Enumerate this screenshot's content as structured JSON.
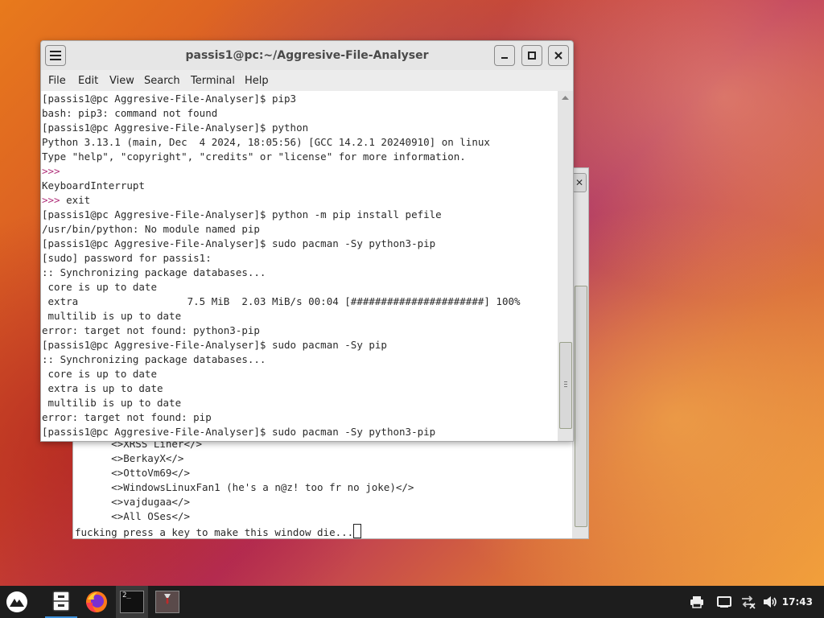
{
  "back_terminal": {
    "close_glyph": "✕",
    "lines": [
      "      <>XRSS Liner</>",
      "      <>BerkayX</>",
      "      <>OttoVm69</>",
      "      <>WindowsLinuxFan1 (he's a n@z! too fr no joke)</>",
      "      <>vajdugaa</>",
      "      <>All OSes</>"
    ],
    "last_line": "fucking press a key to make this window die..."
  },
  "front_terminal": {
    "title": "passis1@pc:~/Aggresive-File-Analyser",
    "menu": [
      "File",
      "Edit",
      "View",
      "Search",
      "Terminal",
      "Help"
    ],
    "lines": [
      "[passis1@pc Aggresive-File-Analyser]$ pip3",
      "bash: pip3: command not found",
      "[passis1@pc Aggresive-File-Analyser]$ python",
      "Python 3.13.1 (main, Dec  4 2024, 18:05:56) [GCC 14.2.1 20240910] on linux",
      "Type \"help\", \"copyright\", \"credits\" or \"license\" for more information.",
      ">>>",
      "KeyboardInterrupt",
      ">>> exit",
      "[passis1@pc Aggresive-File-Analyser]$ python -m pip install pefile",
      "/usr/bin/python: No module named pip",
      "[passis1@pc Aggresive-File-Analyser]$ sudo pacman -Sy python3-pip",
      "[sudo] password for passis1:",
      ":: Synchronizing package databases...",
      " core is up to date",
      " extra                  7.5 MiB  2.03 MiB/s 00:04 [######################] 100%",
      " multilib is up to date",
      "error: target not found: python3-pip",
      "[passis1@pc Aggresive-File-Analyser]$ sudo pacman -Sy pip",
      ":: Synchronizing package databases...",
      " core is up to date",
      " extra is up to date",
      " multilib is up to date",
      "error: target not found: pip",
      "[passis1@pc Aggresive-File-Analyser]$ sudo pacman -Sy python3-pip"
    ]
  },
  "taskbar": {
    "clock": "17:43",
    "terminal_icon_text": "2_"
  },
  "colors": {
    "prompt_pink": "#b0307a",
    "taskbar_bg": "#1d1d1d"
  }
}
